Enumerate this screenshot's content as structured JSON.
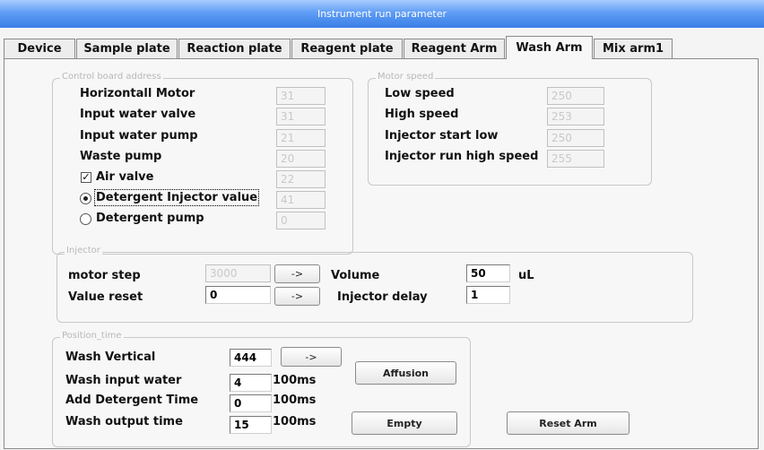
{
  "window": {
    "title": "Instrument run parameter"
  },
  "tabs": [
    {
      "label": "Device"
    },
    {
      "label": "Sample plate"
    },
    {
      "label": "Reaction plate"
    },
    {
      "label": "Reagent plate"
    },
    {
      "label": "Reagent Arm"
    },
    {
      "label": "Wash Arm",
      "active": true
    },
    {
      "label": "Mix arm1"
    }
  ],
  "control_board": {
    "legend": "Control board address",
    "rows": [
      {
        "label": "Horizontall Motor",
        "value": "31"
      },
      {
        "label": "Input water valve",
        "value": "31"
      },
      {
        "label": "Input water pump",
        "value": "21"
      },
      {
        "label": "Waste pump",
        "value": "20"
      },
      {
        "label": "Air valve",
        "value": "22",
        "control": "checkbox",
        "checked": true
      },
      {
        "label": "Detergent Injector value",
        "value": "41",
        "control": "radio",
        "selected": true
      },
      {
        "label": "Detergent pump",
        "value": "0",
        "control": "radio",
        "selected": false
      }
    ]
  },
  "motor_speed": {
    "legend": "Motor speed",
    "rows": [
      {
        "label": "Low speed",
        "value": "250"
      },
      {
        "label": "High speed",
        "value": "253"
      },
      {
        "label": "Injector start low",
        "value": "250"
      },
      {
        "label": "Injector run high speed",
        "value": "255"
      }
    ]
  },
  "injector": {
    "legend": "Injector",
    "motor_step_label": "motor step",
    "motor_step_value": "3000",
    "value_reset_label": "Value reset",
    "value_reset_value": "0",
    "arrow_label": "->",
    "volume_label": "Volume",
    "volume_value": "50",
    "volume_unit": "uL",
    "delay_label": "Injector delay",
    "delay_value": "1"
  },
  "position_time": {
    "legend": "Position_time",
    "wash_vertical_label": "Wash Vertical",
    "wash_vertical_value": "444",
    "arrow_label": "->",
    "wash_input_label": "Wash input water",
    "wash_input_value": "4",
    "add_detergent_label": "Add Detergent Time",
    "add_detergent_value": "0",
    "wash_output_label": "Wash output time",
    "wash_output_value": "15",
    "unit": "100ms"
  },
  "buttons": {
    "affusion": "Affusion",
    "empty": "Empty",
    "reset_arm": "Reset Arm"
  }
}
